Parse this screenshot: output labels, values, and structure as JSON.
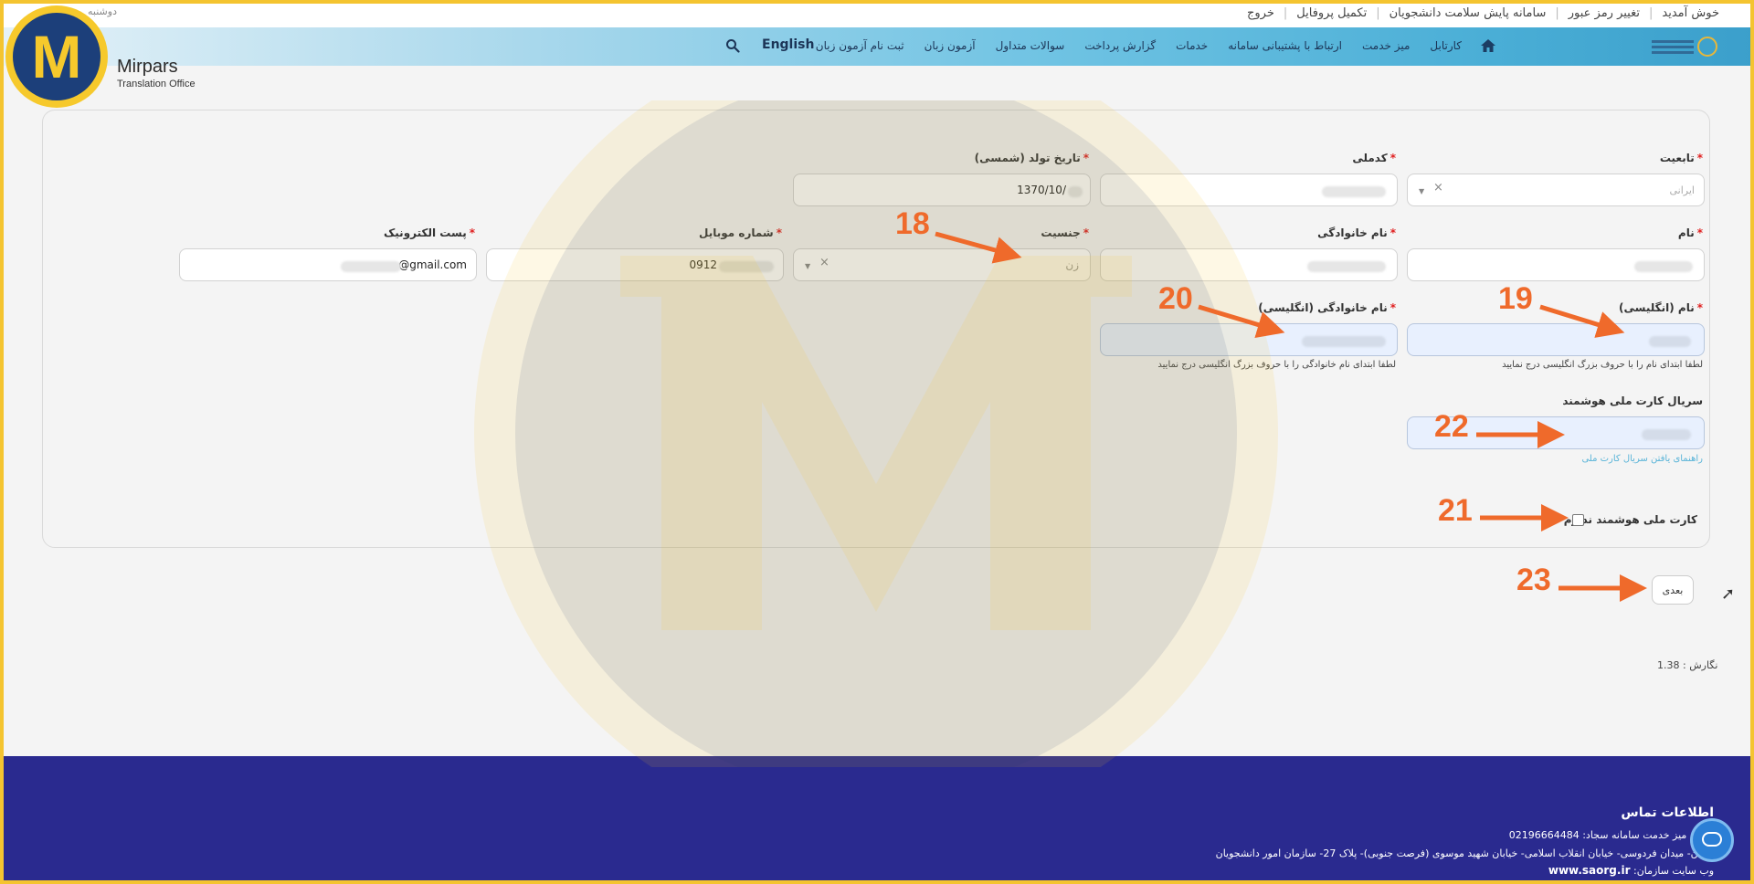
{
  "topbar": {
    "links": [
      "خوش آمدید",
      "تغییر رمز عبور",
      "سامانه پایش سلامت دانشجویان",
      "تکمیل پروفایل",
      "خروج"
    ],
    "date": "دوشنبه"
  },
  "nav": {
    "items": [
      "کارتابل",
      "میز خدمت",
      "ارتباط با پشتیبانی سامانه",
      "خدمات",
      "گزارش پرداخت",
      "سوالات متداول",
      "آزمون زبان",
      "ثبت نام آزمون زبان"
    ],
    "english": "English"
  },
  "brand": {
    "letter": "M",
    "name": "Mirpars",
    "sub": "Translation Office"
  },
  "form": {
    "nationality": {
      "label": "تابعیت",
      "placeholder": "ایرانی"
    },
    "national_code": {
      "label": "کدملی"
    },
    "birth_date": {
      "label": "تاریخ تولد (شمسی)",
      "value": "1370/10/"
    },
    "first_name": {
      "label": "نام"
    },
    "last_name": {
      "label": "نام خانوادگی"
    },
    "gender": {
      "label": "جنسیت",
      "value": "زن"
    },
    "mobile": {
      "label": "شماره موبایل",
      "value": "0912"
    },
    "email": {
      "label": "پست الکترونیک",
      "value": "@gmail.com"
    },
    "first_name_en": {
      "label": "نام (انگلیسی)",
      "hint": "لطفا ابتدای نام را با حروف بزرگ انگلیسی درج نمایید"
    },
    "last_name_en": {
      "label": "نام خانوادگی (انگلیسی)",
      "hint": "لطفا ابتدای نام خانوادگی را با حروف بزرگ انگلیسی درج نمایید"
    },
    "card_serial": {
      "label": "سریال کارت ملی هوشمند",
      "hint": "راهنمای یافتن سریال کارت ملی"
    },
    "no_smart_card": {
      "label": "کارت ملی هوشمند ندارم"
    }
  },
  "next_button": "بعدی",
  "version": "نگارش : 1.38",
  "annotations": [
    "18",
    "19",
    "20",
    "21",
    "22",
    "23"
  ],
  "footer": {
    "title": "اطلاعات تماس",
    "phone": "تماس میز خدمت سامانه سجاد: 02196664484",
    "address": "تهران- میدان فردوسی- خیابان انقلاب اسلامی- خیابان شهید موسوی (فرصت جنوبی)- پلاک 27- سازمان امور دانشجویان",
    "site_label": "وب سایت سازمان:",
    "site": "www.saorg.ir"
  },
  "colors": {
    "accent": "#ef6a2b",
    "footer": "#2a2a8f",
    "brand_yellow": "#f6c92c",
    "brand_blue": "#1c3f7a"
  }
}
